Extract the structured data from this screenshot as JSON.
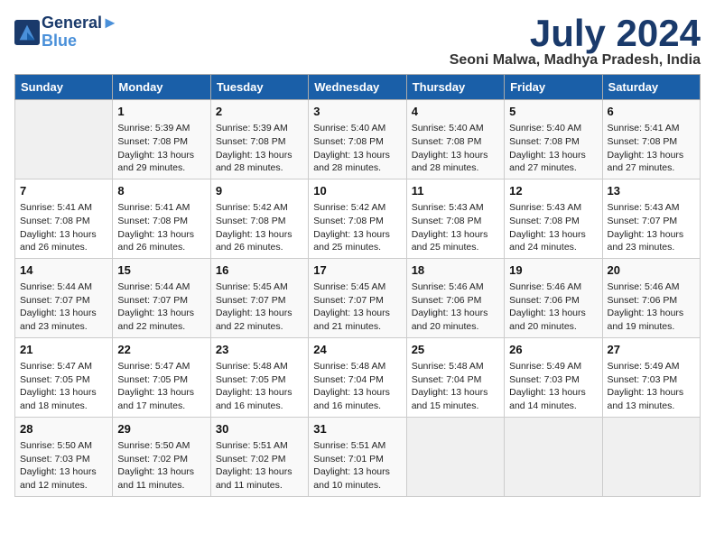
{
  "header": {
    "logo_line1": "General",
    "logo_line2": "Blue",
    "month_title": "July 2024",
    "location": "Seoni Malwa, Madhya Pradesh, India"
  },
  "columns": [
    "Sunday",
    "Monday",
    "Tuesday",
    "Wednesday",
    "Thursday",
    "Friday",
    "Saturday"
  ],
  "weeks": [
    [
      {
        "day": "",
        "content": ""
      },
      {
        "day": "1",
        "content": "Sunrise: 5:39 AM\nSunset: 7:08 PM\nDaylight: 13 hours\nand 29 minutes."
      },
      {
        "day": "2",
        "content": "Sunrise: 5:39 AM\nSunset: 7:08 PM\nDaylight: 13 hours\nand 28 minutes."
      },
      {
        "day": "3",
        "content": "Sunrise: 5:40 AM\nSunset: 7:08 PM\nDaylight: 13 hours\nand 28 minutes."
      },
      {
        "day": "4",
        "content": "Sunrise: 5:40 AM\nSunset: 7:08 PM\nDaylight: 13 hours\nand 28 minutes."
      },
      {
        "day": "5",
        "content": "Sunrise: 5:40 AM\nSunset: 7:08 PM\nDaylight: 13 hours\nand 27 minutes."
      },
      {
        "day": "6",
        "content": "Sunrise: 5:41 AM\nSunset: 7:08 PM\nDaylight: 13 hours\nand 27 minutes."
      }
    ],
    [
      {
        "day": "7",
        "content": "Sunrise: 5:41 AM\nSunset: 7:08 PM\nDaylight: 13 hours\nand 26 minutes."
      },
      {
        "day": "8",
        "content": "Sunrise: 5:41 AM\nSunset: 7:08 PM\nDaylight: 13 hours\nand 26 minutes."
      },
      {
        "day": "9",
        "content": "Sunrise: 5:42 AM\nSunset: 7:08 PM\nDaylight: 13 hours\nand 26 minutes."
      },
      {
        "day": "10",
        "content": "Sunrise: 5:42 AM\nSunset: 7:08 PM\nDaylight: 13 hours\nand 25 minutes."
      },
      {
        "day": "11",
        "content": "Sunrise: 5:43 AM\nSunset: 7:08 PM\nDaylight: 13 hours\nand 25 minutes."
      },
      {
        "day": "12",
        "content": "Sunrise: 5:43 AM\nSunset: 7:08 PM\nDaylight: 13 hours\nand 24 minutes."
      },
      {
        "day": "13",
        "content": "Sunrise: 5:43 AM\nSunset: 7:07 PM\nDaylight: 13 hours\nand 23 minutes."
      }
    ],
    [
      {
        "day": "14",
        "content": "Sunrise: 5:44 AM\nSunset: 7:07 PM\nDaylight: 13 hours\nand 23 minutes."
      },
      {
        "day": "15",
        "content": "Sunrise: 5:44 AM\nSunset: 7:07 PM\nDaylight: 13 hours\nand 22 minutes."
      },
      {
        "day": "16",
        "content": "Sunrise: 5:45 AM\nSunset: 7:07 PM\nDaylight: 13 hours\nand 22 minutes."
      },
      {
        "day": "17",
        "content": "Sunrise: 5:45 AM\nSunset: 7:07 PM\nDaylight: 13 hours\nand 21 minutes."
      },
      {
        "day": "18",
        "content": "Sunrise: 5:46 AM\nSunset: 7:06 PM\nDaylight: 13 hours\nand 20 minutes."
      },
      {
        "day": "19",
        "content": "Sunrise: 5:46 AM\nSunset: 7:06 PM\nDaylight: 13 hours\nand 20 minutes."
      },
      {
        "day": "20",
        "content": "Sunrise: 5:46 AM\nSunset: 7:06 PM\nDaylight: 13 hours\nand 19 minutes."
      }
    ],
    [
      {
        "day": "21",
        "content": "Sunrise: 5:47 AM\nSunset: 7:05 PM\nDaylight: 13 hours\nand 18 minutes."
      },
      {
        "day": "22",
        "content": "Sunrise: 5:47 AM\nSunset: 7:05 PM\nDaylight: 13 hours\nand 17 minutes."
      },
      {
        "day": "23",
        "content": "Sunrise: 5:48 AM\nSunset: 7:05 PM\nDaylight: 13 hours\nand 16 minutes."
      },
      {
        "day": "24",
        "content": "Sunrise: 5:48 AM\nSunset: 7:04 PM\nDaylight: 13 hours\nand 16 minutes."
      },
      {
        "day": "25",
        "content": "Sunrise: 5:48 AM\nSunset: 7:04 PM\nDaylight: 13 hours\nand 15 minutes."
      },
      {
        "day": "26",
        "content": "Sunrise: 5:49 AM\nSunset: 7:03 PM\nDaylight: 13 hours\nand 14 minutes."
      },
      {
        "day": "27",
        "content": "Sunrise: 5:49 AM\nSunset: 7:03 PM\nDaylight: 13 hours\nand 13 minutes."
      }
    ],
    [
      {
        "day": "28",
        "content": "Sunrise: 5:50 AM\nSunset: 7:03 PM\nDaylight: 13 hours\nand 12 minutes."
      },
      {
        "day": "29",
        "content": "Sunrise: 5:50 AM\nSunset: 7:02 PM\nDaylight: 13 hours\nand 11 minutes."
      },
      {
        "day": "30",
        "content": "Sunrise: 5:51 AM\nSunset: 7:02 PM\nDaylight: 13 hours\nand 11 minutes."
      },
      {
        "day": "31",
        "content": "Sunrise: 5:51 AM\nSunset: 7:01 PM\nDaylight: 13 hours\nand 10 minutes."
      },
      {
        "day": "",
        "content": ""
      },
      {
        "day": "",
        "content": ""
      },
      {
        "day": "",
        "content": ""
      }
    ]
  ]
}
